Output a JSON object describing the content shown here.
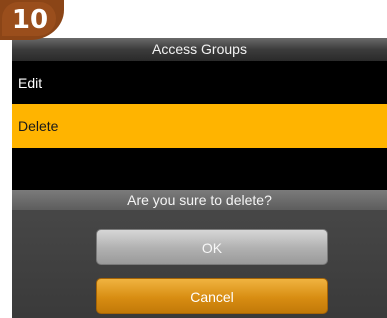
{
  "step_badge": {
    "number": "10"
  },
  "titlebar": {
    "title": "Access Groups"
  },
  "menu": {
    "items": [
      {
        "label": "Edit",
        "selected": false
      },
      {
        "label": "Delete",
        "selected": true
      }
    ]
  },
  "dialog": {
    "message": "Are you sure to delete?",
    "ok_label": "OK",
    "cancel_label": "Cancel"
  },
  "colors": {
    "selection": "#ffb400",
    "cancel_button": "#d88d12",
    "ok_button": "#b0b0b0",
    "badge": "#8b4517"
  }
}
